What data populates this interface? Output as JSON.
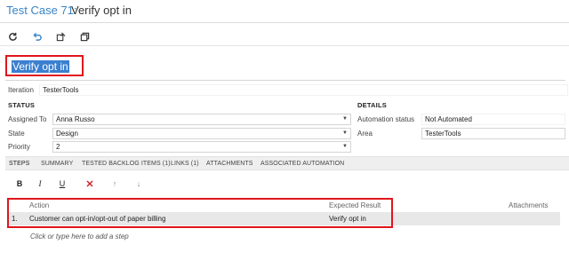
{
  "header": {
    "prefix": "Test Case 71:",
    "title": "Verify opt in"
  },
  "toolbar": {
    "buttons": [
      {
        "name": "refresh-icon"
      },
      {
        "name": "undo-icon"
      },
      {
        "name": "save-and-close-icon"
      },
      {
        "name": "copy-icon"
      }
    ]
  },
  "title_field": {
    "value": "Verify opt in"
  },
  "iteration": {
    "label": "Iteration",
    "value": "TesterTools"
  },
  "status": {
    "heading": "STATUS",
    "assigned_to": {
      "label": "Assigned To",
      "value": "Anna Russo"
    },
    "state": {
      "label": "State",
      "value": "Design"
    },
    "priority": {
      "label": "Priority",
      "value": "2"
    }
  },
  "details": {
    "heading": "DETAILS",
    "automation_status": {
      "label": "Automation status",
      "value": "Not Automated"
    },
    "area": {
      "label": "Area",
      "value": "TesterTools"
    }
  },
  "tabs": [
    {
      "label": "STEPS",
      "active": true
    },
    {
      "label": "SUMMARY"
    },
    {
      "label": "TESTED BACKLOG ITEMS (1)"
    },
    {
      "label": "LINKS (1)"
    },
    {
      "label": "ATTACHMENTS"
    },
    {
      "label": "ASSOCIATED AUTOMATION"
    }
  ],
  "step_toolbar": {
    "bold": "B",
    "italic": "I",
    "underline": "U",
    "delete": "✕",
    "move_up": "↑",
    "move_down": "↓"
  },
  "steps": {
    "columns": {
      "action": "Action",
      "expected": "Expected Result",
      "attachments": "Attachments"
    },
    "rows": [
      {
        "num": "1.",
        "action": "Customer can opt-in/opt-out of paper billing",
        "expected": "Verify opt in"
      }
    ],
    "add_placeholder": "Click or type here to add a step"
  },
  "colors": {
    "accent": "#3a84c6",
    "highlight": "#e0161b",
    "selection": "#3b7fd0"
  }
}
